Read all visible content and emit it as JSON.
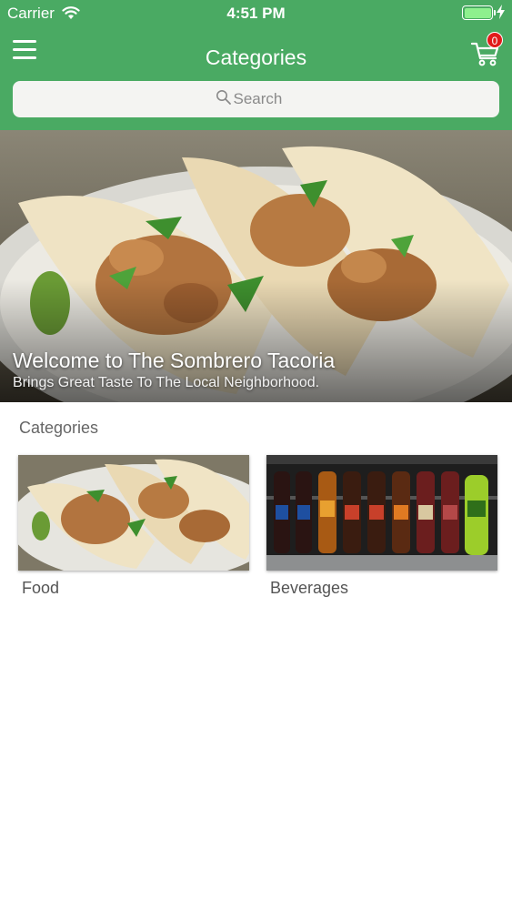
{
  "status_bar": {
    "carrier": "Carrier",
    "time": "4:51 PM",
    "battery_level": 1.0,
    "wifi_icon": "wifi-icon",
    "charging_icon": "bolt-icon"
  },
  "nav": {
    "title": "Categories",
    "menu_icon": "hamburger-menu-icon",
    "cart_icon": "shopping-cart-icon",
    "cart_count": "0"
  },
  "search": {
    "placeholder": "Search",
    "icon": "search-icon"
  },
  "hero": {
    "title": "Welcome to The Sombrero Tacoria",
    "subtitle": "Brings Great Taste To The Local Neighborhood."
  },
  "categories": {
    "heading": "Categories",
    "items": [
      {
        "label": "Food"
      },
      {
        "label": "Beverages"
      }
    ]
  },
  "colors": {
    "header_green": "#4aaa63",
    "badge_red": "#e11b1b",
    "search_bg": "#f4f4f2"
  }
}
